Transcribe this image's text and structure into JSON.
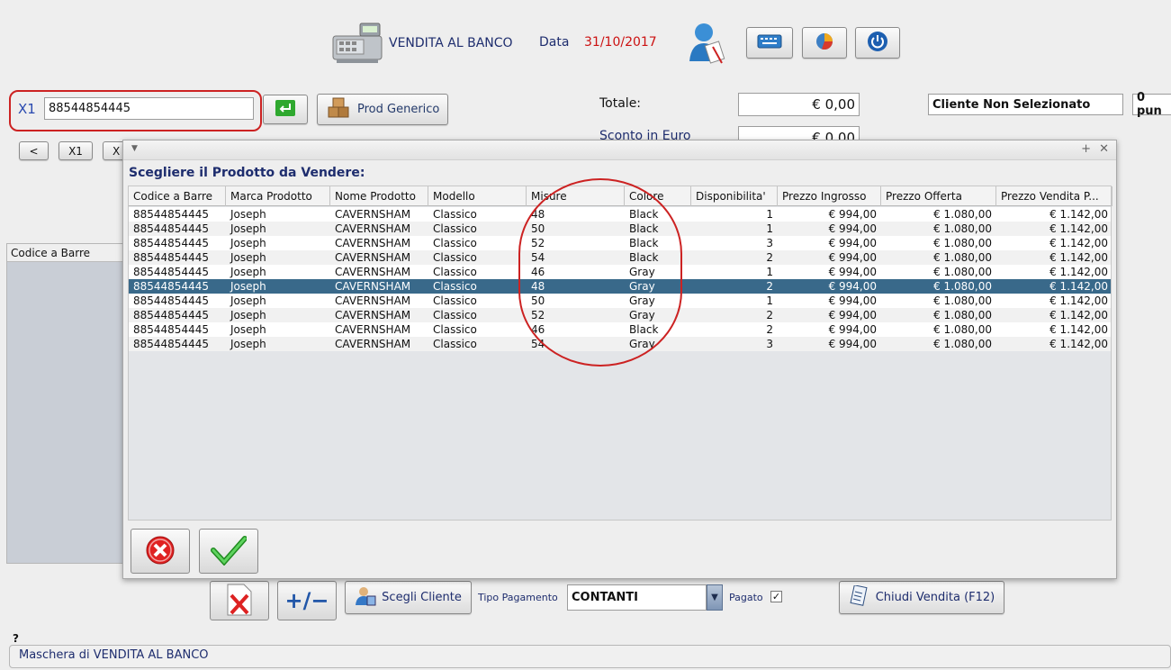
{
  "header": {
    "title": "VENDITA AL BANCO",
    "data_label": "Data",
    "date": "31/10/2017",
    "colors": {
      "date": "#cc1111",
      "title": "#1e2d6e"
    }
  },
  "input_row": {
    "label": "X1",
    "barcode_value": "88544854445",
    "generic_button": "Prod Generico"
  },
  "totals": {
    "totale_label": "Totale:",
    "totale_value": "€ 0,00",
    "sconto_label": "Sconto in Euro",
    "sconto_value": "€ 0,00",
    "cliente": "Cliente Non Selezionato",
    "punti": "0 pun"
  },
  "quick_buttons": [
    "<",
    "X1",
    "X"
  ],
  "left_panel_header": "Codice a Barre",
  "dialog": {
    "heading": "Scegliere il Prodotto da Vendere:",
    "columns": [
      "Codice a Barre",
      "Marca Prodotto",
      "Nome Prodotto",
      "Modello",
      "Misure",
      "Colore",
      "Disponibilita'",
      "Prezzo Ingrosso",
      "Prezzo Offerta",
      "Prezzo Vendita P..."
    ],
    "rows": [
      [
        "88544854445",
        "Joseph",
        "CAVERNSHAM",
        "Classico",
        "48",
        "Black",
        "1",
        "€ 994,00",
        "€ 1.080,00",
        "€ 1.142,00"
      ],
      [
        "88544854445",
        "Joseph",
        "CAVERNSHAM",
        "Classico",
        "50",
        "Black",
        "1",
        "€ 994,00",
        "€ 1.080,00",
        "€ 1.142,00"
      ],
      [
        "88544854445",
        "Joseph",
        "CAVERNSHAM",
        "Classico",
        "52",
        "Black",
        "3",
        "€ 994,00",
        "€ 1.080,00",
        "€ 1.142,00"
      ],
      [
        "88544854445",
        "Joseph",
        "CAVERNSHAM",
        "Classico",
        "54",
        "Black",
        "2",
        "€ 994,00",
        "€ 1.080,00",
        "€ 1.142,00"
      ],
      [
        "88544854445",
        "Joseph",
        "CAVERNSHAM",
        "Classico",
        "46",
        "Gray",
        "1",
        "€ 994,00",
        "€ 1.080,00",
        "€ 1.142,00"
      ],
      [
        "88544854445",
        "Joseph",
        "CAVERNSHAM",
        "Classico",
        "48",
        "Gray",
        "2",
        "€ 994,00",
        "€ 1.080,00",
        "€ 1.142,00"
      ],
      [
        "88544854445",
        "Joseph",
        "CAVERNSHAM",
        "Classico",
        "50",
        "Gray",
        "1",
        "€ 994,00",
        "€ 1.080,00",
        "€ 1.142,00"
      ],
      [
        "88544854445",
        "Joseph",
        "CAVERNSHAM",
        "Classico",
        "52",
        "Gray",
        "2",
        "€ 994,00",
        "€ 1.080,00",
        "€ 1.142,00"
      ],
      [
        "88544854445",
        "Joseph",
        "CAVERNSHAM",
        "Classico",
        "46",
        "Black",
        "2",
        "€ 994,00",
        "€ 1.080,00",
        "€ 1.142,00"
      ],
      [
        "88544854445",
        "Joseph",
        "CAVERNSHAM",
        "Classico",
        "54",
        "Gray",
        "3",
        "€ 994,00",
        "€ 1.080,00",
        "€ 1.142,00"
      ]
    ],
    "selected_row": 5,
    "colors": {
      "selection": "#39698a",
      "annotation": "#cc2222"
    }
  },
  "bottom_bar": {
    "scegli_cliente": "Scegli Cliente",
    "tipo_pagamento_label": "Tipo Pagamento",
    "tipo_pagamento_value": "CONTANTI",
    "pagato_label": "Pagato",
    "pagato_checked": true,
    "chiudi_button": "Chiudi Vendita (F12)",
    "plus_minus": "+/−"
  },
  "status": {
    "help_mark": "?",
    "text": "Maschera di VENDITA AL BANCO"
  },
  "icons": [
    "cash-register-icon",
    "user-edit-icon",
    "keyboard-icon",
    "pie-chart-icon",
    "power-icon",
    "enter-icon",
    "boxes-icon",
    "delete-document-icon",
    "customer-icon",
    "receipt-icon",
    "cancel-icon",
    "confirm-icon",
    "dropdown-arrow-icon"
  ]
}
